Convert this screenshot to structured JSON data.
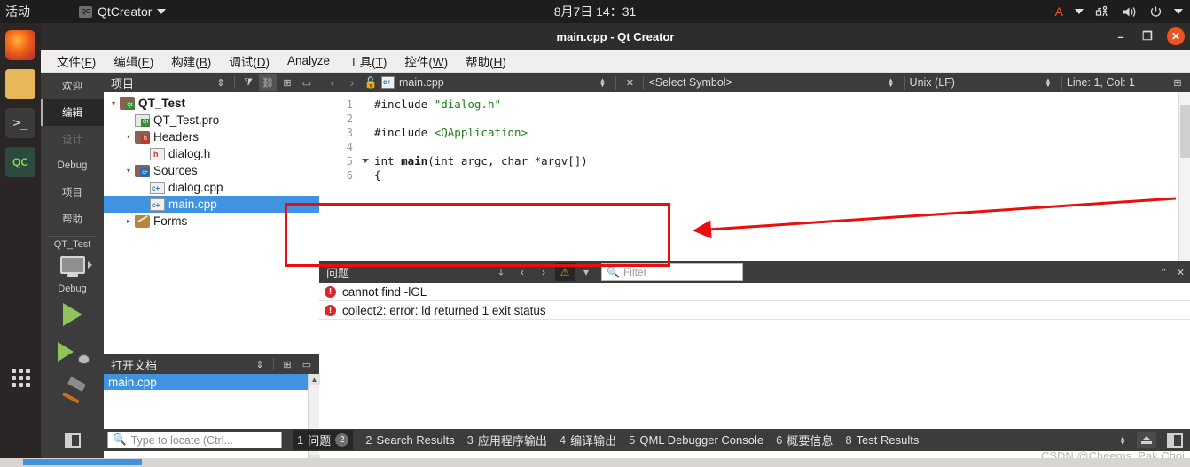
{
  "desktop": {
    "activities": "活动",
    "app_menu": {
      "icon": "qtcreator-icon",
      "label": "QtCreator",
      "badge": "QC"
    },
    "clock": "8月7日  14：31",
    "tray": {
      "input_method": "A",
      "accessibility_icon": "accessibility-icon",
      "volume_icon": "volume-icon",
      "power_icon": "power-icon"
    }
  },
  "launcher": {
    "items": [
      {
        "name": "firefox",
        "label": ""
      },
      {
        "name": "files",
        "label": ""
      },
      {
        "name": "terminal",
        "label": ">_"
      },
      {
        "name": "qtcreator",
        "label": "QC"
      },
      {
        "name": "show-applications",
        "label": ""
      }
    ]
  },
  "window": {
    "title": "main.cpp - Qt Creator",
    "minimize": "–",
    "maximize": "❐",
    "close": "✕"
  },
  "menubar": {
    "items": [
      {
        "pre": "文件(",
        "key": "F",
        "post": ")"
      },
      {
        "pre": "编辑(",
        "key": "E",
        "post": ")"
      },
      {
        "pre": "构建(",
        "key": "B",
        "post": ")"
      },
      {
        "pre": "调试(",
        "key": "D",
        "post": ")"
      },
      {
        "pre": "",
        "key": "A",
        "post": "nalyze"
      },
      {
        "pre": "工具(",
        "key": "T",
        "post": ")"
      },
      {
        "pre": "控件(",
        "key": "W",
        "post": ")"
      },
      {
        "pre": "帮助(",
        "key": "H",
        "post": ")"
      }
    ]
  },
  "modebar": {
    "items": [
      {
        "label": "欢迎",
        "state": "normal"
      },
      {
        "label": "编辑",
        "state": "active"
      },
      {
        "label": "设计",
        "state": "disabled"
      },
      {
        "label": "Debug",
        "state": "normal"
      },
      {
        "label": "项目",
        "state": "normal"
      },
      {
        "label": "帮助",
        "state": "normal"
      }
    ],
    "kit": {
      "project": "QT_Test",
      "config": "Debug"
    },
    "actions": [
      {
        "name": "run-button",
        "label": ""
      },
      {
        "name": "debug-button",
        "label": ""
      },
      {
        "name": "build-button",
        "label": ""
      }
    ]
  },
  "project_pane": {
    "title": "项目",
    "tools": [
      "filter-icon",
      "link-icon",
      "split-icon",
      "collapse-icon"
    ],
    "tree": [
      {
        "depth": 0,
        "twist": "▾",
        "icon": "folder-qt",
        "label": "QT_Test",
        "bold": true,
        "selected": false
      },
      {
        "depth": 1,
        "twist": "",
        "icon": "file-pro",
        "label": "QT_Test.pro",
        "bold": false,
        "selected": false
      },
      {
        "depth": 1,
        "twist": "▾",
        "icon": "folder-h",
        "label": "Headers",
        "bold": false,
        "selected": false
      },
      {
        "depth": 2,
        "twist": "",
        "icon": "file-h",
        "label": "dialog.h",
        "bold": false,
        "selected": false
      },
      {
        "depth": 1,
        "twist": "▾",
        "icon": "folder-cpp",
        "label": "Sources",
        "bold": false,
        "selected": false
      },
      {
        "depth": 2,
        "twist": "",
        "icon": "file-cpp",
        "label": "dialog.cpp",
        "bold": false,
        "selected": false
      },
      {
        "depth": 2,
        "twist": "",
        "icon": "file-cpp",
        "label": "main.cpp",
        "bold": false,
        "selected": true
      },
      {
        "depth": 1,
        "twist": "▸",
        "icon": "folder-forms",
        "label": "Forms",
        "bold": false,
        "selected": false
      }
    ]
  },
  "opendocs_pane": {
    "title": "打开文档",
    "items": [
      {
        "label": "main.cpp",
        "selected": true
      }
    ]
  },
  "editor_toolbar": {
    "file_name": "main.cpp",
    "close_label": "✕",
    "symbol_selector": "<Select Symbol>",
    "line_ending": "Unix (LF)",
    "cursor_position": "Line: 1, Col: 1"
  },
  "editor": {
    "lines": [
      {
        "num": "1",
        "fold": false,
        "tokens": [
          {
            "t": "#include ",
            "c": "pre"
          },
          {
            "t": "\"dialog.h\"",
            "c": "str"
          }
        ]
      },
      {
        "num": "2",
        "fold": false,
        "tokens": []
      },
      {
        "num": "3",
        "fold": false,
        "tokens": [
          {
            "t": "#include ",
            "c": "pre"
          },
          {
            "t": "<QApplication>",
            "c": "str"
          }
        ]
      },
      {
        "num": "4",
        "fold": false,
        "tokens": []
      },
      {
        "num": "5",
        "fold": true,
        "tokens": [
          {
            "t": "int ",
            "c": "type"
          },
          {
            "t": "main",
            "c": "fn"
          },
          {
            "t": "(int argc, char *argv[])",
            "c": "plain"
          }
        ]
      },
      {
        "num": "6",
        "fold": false,
        "tokens": [
          {
            "t": "{",
            "c": "plain"
          }
        ]
      }
    ]
  },
  "issues_panel": {
    "title": "问题",
    "filter_placeholder": "Filter",
    "toolbar_icons": [
      "export-icon",
      "prev-issue-icon",
      "next-issue-icon",
      "warning-filter-icon",
      "filter-dropdown-icon"
    ],
    "rows": [
      {
        "severity": "error",
        "message": "cannot find -lGL"
      },
      {
        "severity": "error",
        "message": "collect2: error: ld returned 1 exit status"
      }
    ]
  },
  "bottom_bar": {
    "locator_placeholder": "Type to locate (Ctrl...",
    "tabs": [
      {
        "num": "1",
        "label": "问题",
        "badge": "2",
        "active": true
      },
      {
        "num": "2",
        "label": "Search Results",
        "badge": "",
        "active": false
      },
      {
        "num": "3",
        "label": "应用程序输出",
        "badge": "",
        "active": false
      },
      {
        "num": "4",
        "label": "编译输出",
        "badge": "",
        "active": false
      },
      {
        "num": "5",
        "label": "QML Debugger Console",
        "badge": "",
        "active": false
      },
      {
        "num": "6",
        "label": "概要信息",
        "badge": "",
        "active": false
      },
      {
        "num": "8",
        "label": "Test Results",
        "badge": "",
        "active": false
      }
    ]
  },
  "watermark": "CSDN @Cheems_Pak Choi",
  "colors": {
    "accent_blue": "#3f93e0",
    "error_red": "#d9262c",
    "annotation_red": "#e8100f",
    "ubuntu_orange": "#e95420",
    "panel_dark": "#3c3c3c"
  }
}
